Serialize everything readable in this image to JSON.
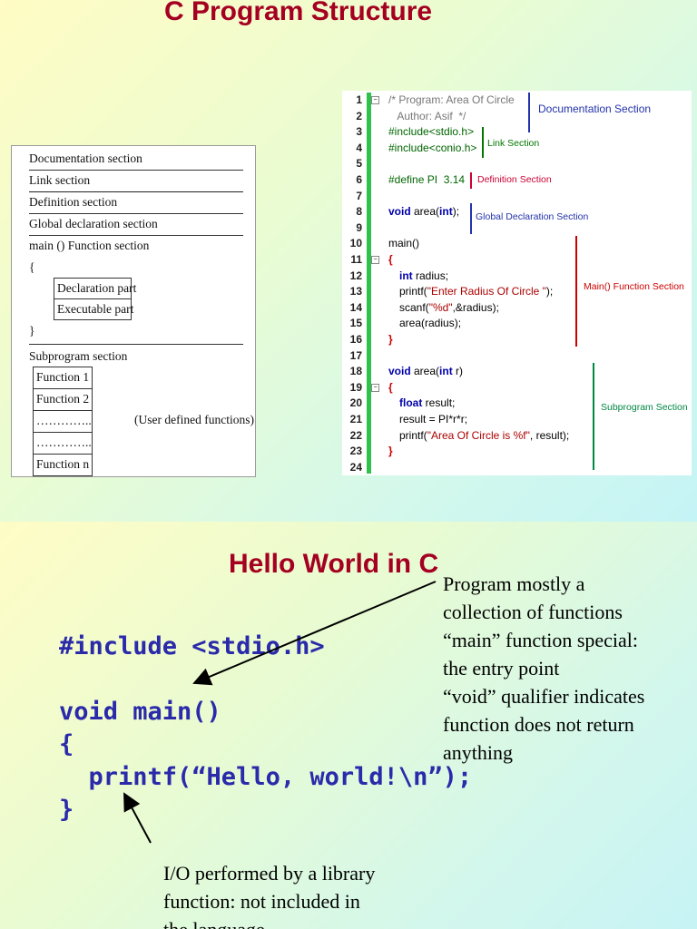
{
  "slide1": {
    "title": "C Program Structure",
    "structure": {
      "documentation": "Documentation section",
      "link": "Link section",
      "definition": "Definition section",
      "global": "Global declaration section",
      "main": "main () Function section",
      "open_brace": "{",
      "declaration": "Declaration part",
      "executable": "Executable part",
      "close_brace": "}",
      "subprogram": "Subprogram section",
      "functions": [
        "Function 1",
        "Function 2",
        "…………..",
        "…………..",
        "Function n"
      ],
      "user_defined": "(User defined functions)"
    },
    "code_image": {
      "line_numbers": [
        "1",
        "2",
        "3",
        "4",
        "5",
        "6",
        "7",
        "8",
        "9",
        "10",
        "11",
        "12",
        "13",
        "14",
        "15",
        "16",
        "17",
        "18",
        "19",
        "20",
        "21",
        "22",
        "23",
        "24"
      ],
      "lines": {
        "l1": "/* Program: Area Of Circle",
        "l2": "   Author: Asif  */",
        "l3": "#include<stdio.h>",
        "l4": "#include<conio.h>",
        "l6": "#define PI  3.14",
        "l8_kw": "void",
        "l8_rest": " area(",
        "l8_kw2": "int",
        "l8_end": ");",
        "l10": "main()",
        "l11": "{",
        "l12_kw": "int",
        "l12_rest": " radius;",
        "l13_a": "printf(",
        "l13_str": "\"Enter Radius Of Circle \"",
        "l13_b": ");",
        "l14_a": "scanf(",
        "l14_str": "\"%d\"",
        "l14_b": ",&radius);",
        "l15": "area(radius);",
        "l16": "}",
        "l18_kw": "void",
        "l18_rest": " area(",
        "l18_kw2": "int",
        "l18_end": " r)",
        "l19": "{",
        "l20_kw": "float",
        "l20_rest": " result;",
        "l21": "result = PI*r*r;",
        "l22_a": "printf(",
        "l22_str": "\"Area Of Circle is %f\"",
        "l22_b": ", result);",
        "l23": "}"
      },
      "section_labels": {
        "documentation": "Documentation Section",
        "link": "Link Section",
        "definition": "Definition Section",
        "global": "Global Declaration Section",
        "main": "Main() Function Section",
        "subprogram": "Subprogram Section"
      }
    }
  },
  "slide2": {
    "title": "Hello World in C",
    "code": {
      "line1": "#include <stdio.h>",
      "line2": "",
      "line3": "void main()",
      "line4": "{",
      "line5": "  printf(“Hello, world!\\n”);",
      "line6": "}"
    },
    "notes": [
      "Program mostly a",
      "collection of functions",
      "“main” function special:",
      "the entry point",
      "“void” qualifier indicates",
      "function does not return",
      "anything"
    ],
    "io_note": [
      "I/O performed by a library",
      "function: not included in",
      "the language"
    ]
  },
  "colors": {
    "title": "#a50021",
    "code": "#2a2aaa",
    "doc_label": "#2233aa",
    "link_label": "#007700",
    "def_label": "#cc0033",
    "main_label": "#cc0000",
    "sub_label": "#008844"
  }
}
